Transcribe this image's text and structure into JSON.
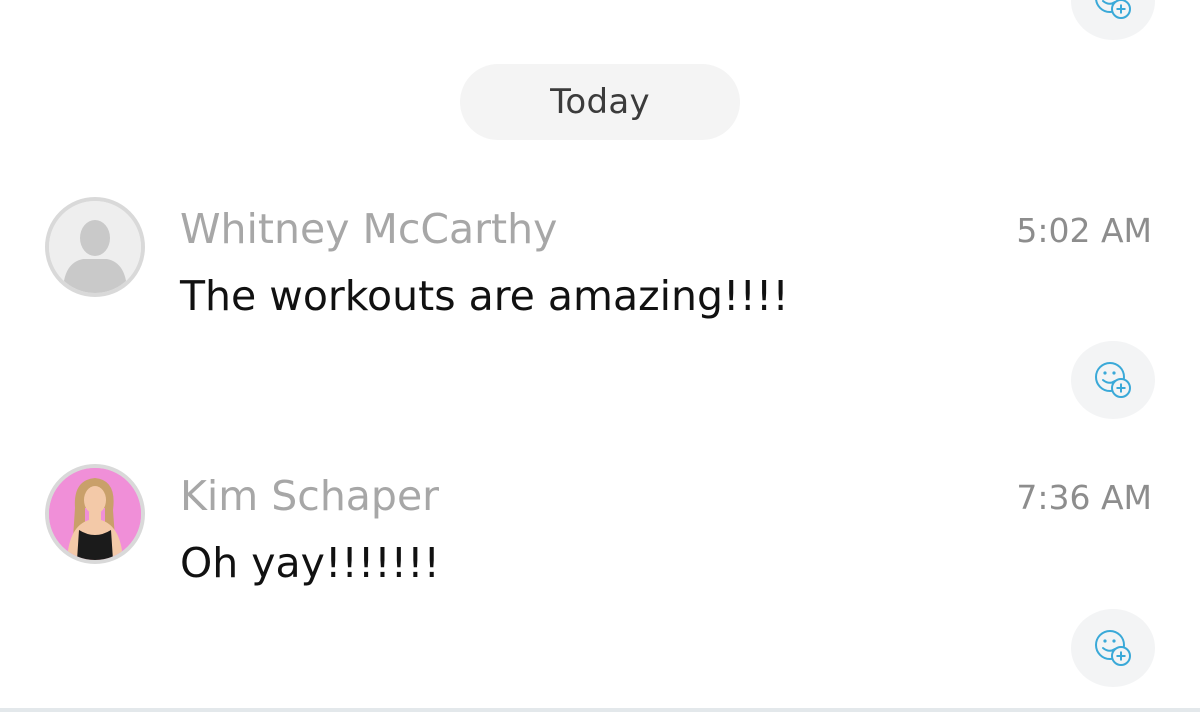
{
  "date_separator": {
    "label": "Today"
  },
  "messages": [
    {
      "sender": "Whitney McCarthy",
      "text": "The workouts are amazing!!!!",
      "time": "5:02 AM",
      "avatar": "default-person-icon"
    },
    {
      "sender": "Kim Schaper",
      "text": "Oh yay!!!!!!!",
      "time": "7:36 AM",
      "avatar": "profile-photo"
    }
  ],
  "icons": {
    "reaction": "add-reaction-icon"
  },
  "colors": {
    "accent": "#3aa9d8",
    "pill_bg": "#f4f4f4",
    "name": "#a7a7a7",
    "time": "#8d8d8d",
    "avatar_photo_bg": "#f08fd8"
  }
}
